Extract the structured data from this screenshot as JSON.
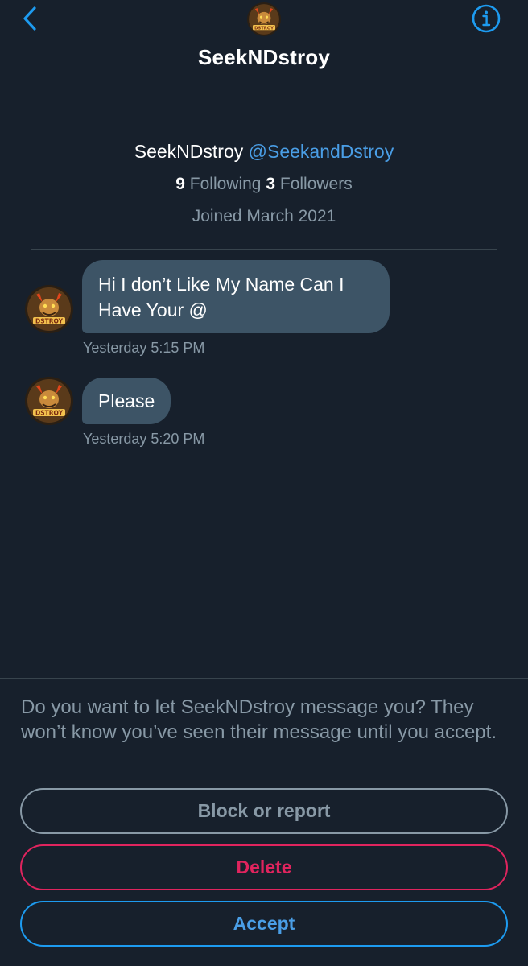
{
  "header": {
    "title": "SeekNDstroy",
    "back_icon": "chevron-left-icon",
    "info_icon": "info-circle-icon",
    "avatar_text": "DSTROY"
  },
  "profile": {
    "name": "SeekNDstroy",
    "handle": "@SeekandDstroy",
    "following_count": "9",
    "following_label": "Following",
    "followers_count": "3",
    "followers_label": "Followers",
    "joined": "Joined March 2021"
  },
  "messages": [
    {
      "text": "Hi I don’t Like My Name Can I Have Your @",
      "time": "Yesterday 5:15 PM",
      "avatar_text": "DSTROY"
    },
    {
      "text": "Please",
      "time": "Yesterday 5:20 PM",
      "avatar_text": "DSTROY"
    }
  ],
  "request": {
    "prompt": "Do you want to let SeekNDstroy message you? They won’t know you’ve seen their message until you accept.",
    "block_label": "Block or report",
    "delete_label": "Delete",
    "accept_label": "Accept"
  },
  "colors": {
    "background": "#17202c",
    "accent": "#1d9bf0",
    "bubble": "#3d5466",
    "muted": "#8899a6",
    "danger": "#e0245e"
  }
}
